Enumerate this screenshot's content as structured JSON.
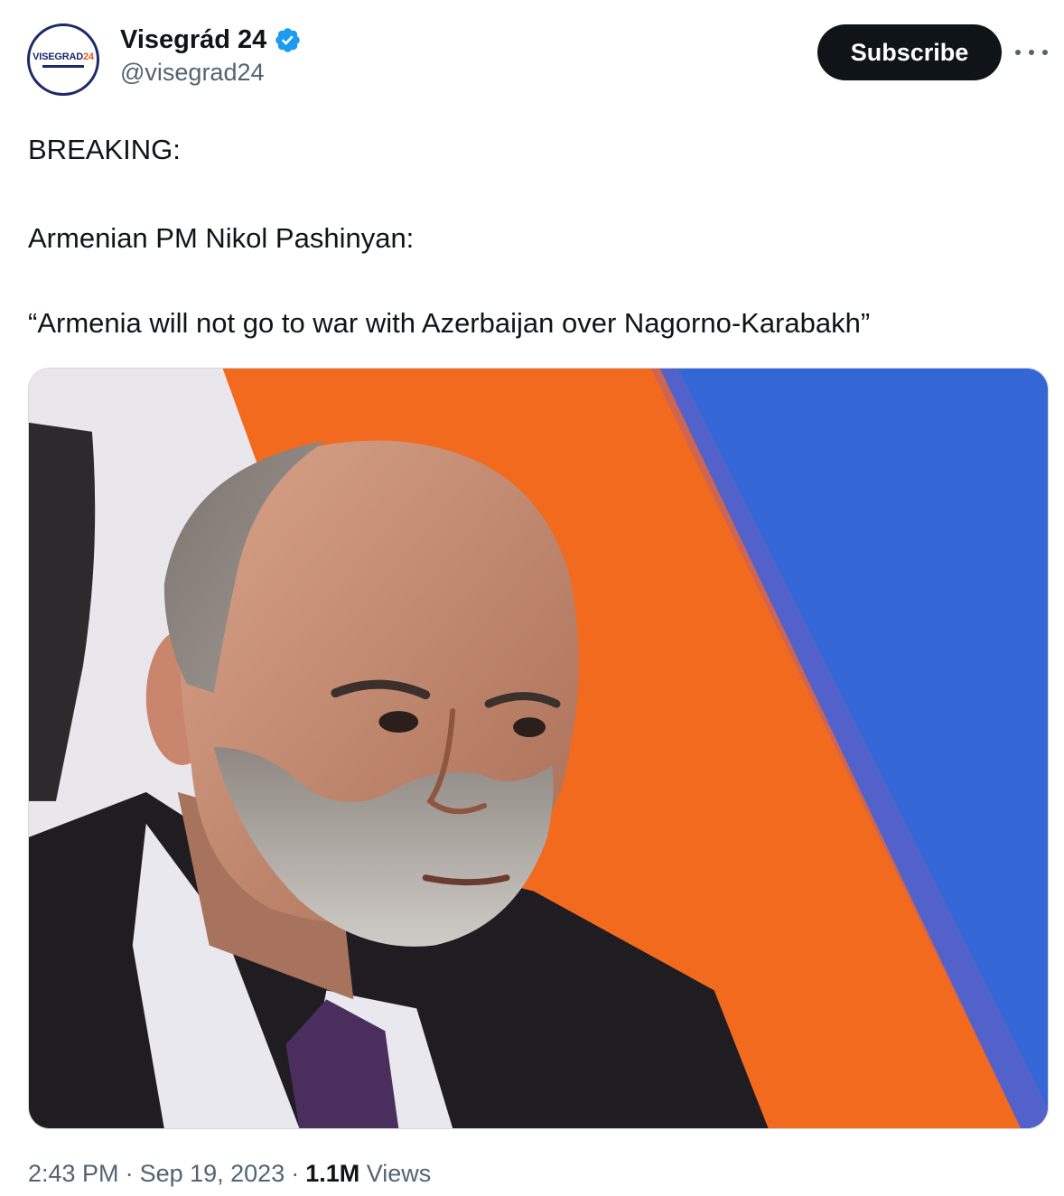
{
  "account": {
    "display_name": "Visegrád 24",
    "handle": "@visegrad24",
    "avatar_logo_main": "VISEGRAD",
    "avatar_logo_accent": "24",
    "verified_icon": "verified-badge-icon"
  },
  "actions": {
    "subscribe_label": "Subscribe",
    "more_icon": "more-horizontal-icon"
  },
  "tweet": {
    "line1": "BREAKING:",
    "line2": "Armenian PM Nikol Pashinyan:",
    "line3": "“Armenia will not go to war with Azerbaijan over Nagorno-Karabakh”"
  },
  "meta": {
    "time": "2:43 PM",
    "date": "Sep 19, 2023",
    "views_count": "1.1M",
    "views_label": "Views",
    "separator": "·"
  },
  "colors": {
    "brand_blue": "#1d9bf0",
    "button_bg": "#0f1419",
    "secondary_text": "#536471",
    "flag_orange": "#f26a1e",
    "flag_blue": "#3566d6"
  }
}
